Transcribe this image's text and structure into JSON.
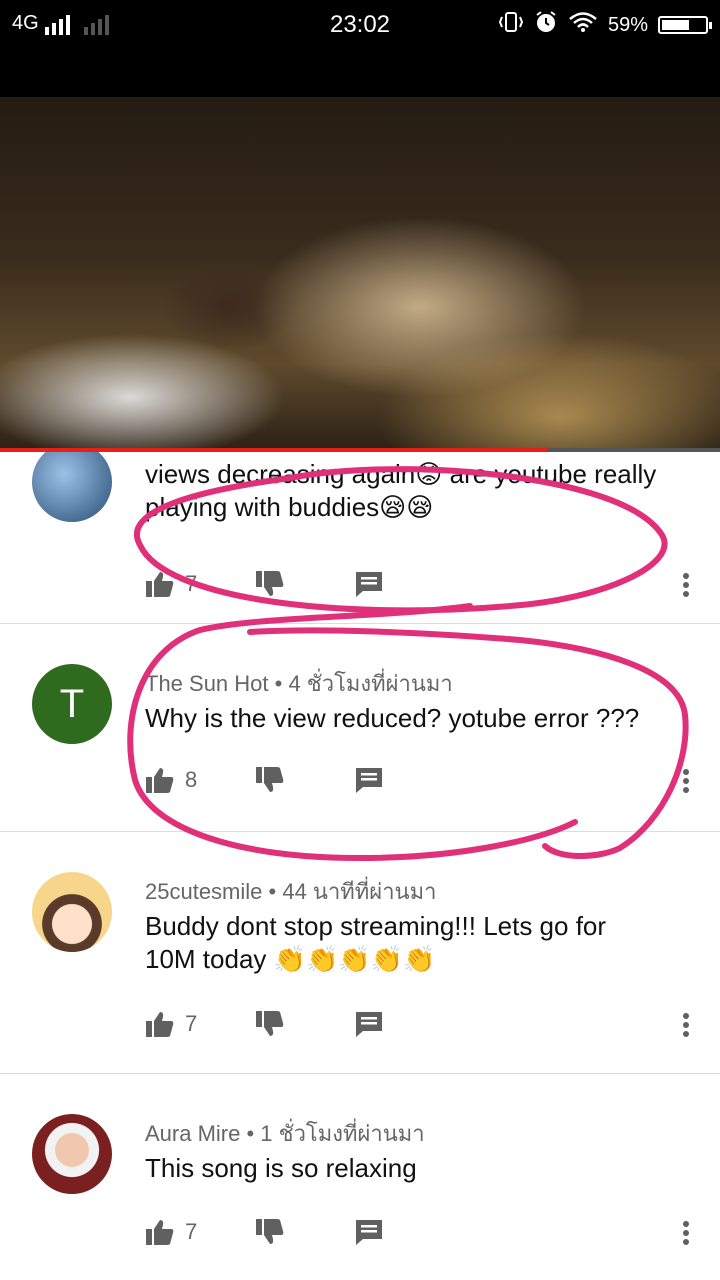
{
  "status_bar": {
    "network": "4G",
    "time": "23:02",
    "battery": "59%",
    "battery_level": 0.59
  },
  "video": {
    "progress": 0.76
  },
  "comments": [
    {
      "author": "",
      "time": "",
      "text_pre": "views decreasing again",
      "emoji1": "😡",
      "text_mid": " are youtube really playing with buddies",
      "emoji2": "😪😪",
      "likes": "7"
    },
    {
      "author": "The Sun Hot",
      "time": "4 ชั่วโมงที่ผ่านมา",
      "avatar_letter": "T",
      "text": "Why is the view reduced? yotube error ???",
      "likes": "8"
    },
    {
      "author": "25cutesmile",
      "time": "44 นาทีที่ผ่านมา",
      "text": "Buddy dont stop streaming!!! Lets go for 10M today",
      "emoji": "👏👏👏👏👏",
      "likes": "7"
    },
    {
      "author": "Aura Mire",
      "time": "1 ชั่วโมงที่ผ่านมา",
      "text": "This song is so relaxing",
      "likes": "7"
    }
  ],
  "colors": {
    "annotation": "#e0307a",
    "avatar_t": "#2e6b1f",
    "progress": "#e62117"
  }
}
